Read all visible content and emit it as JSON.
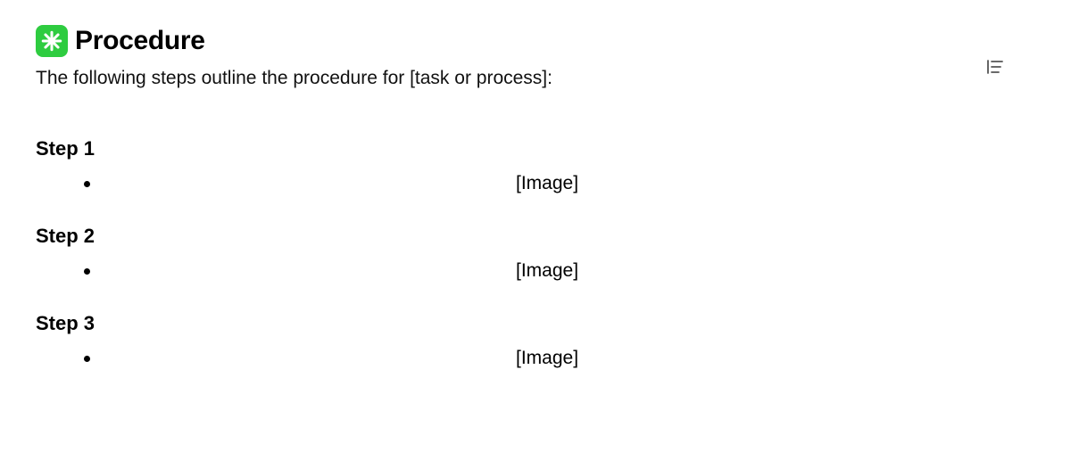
{
  "heading": {
    "icon_name": "asterisk-badge-icon",
    "title": "Procedure"
  },
  "intro": "The following steps outline the procedure for [task or process]:",
  "steps": [
    {
      "title": "Step 1",
      "placeholder": "[Image]"
    },
    {
      "title": "Step 2",
      "placeholder": "[Image]"
    },
    {
      "title": "Step 3",
      "placeholder": "[Image]"
    }
  ],
  "toolbar": {
    "outline_toggle_name": "outline-toggle-icon"
  }
}
